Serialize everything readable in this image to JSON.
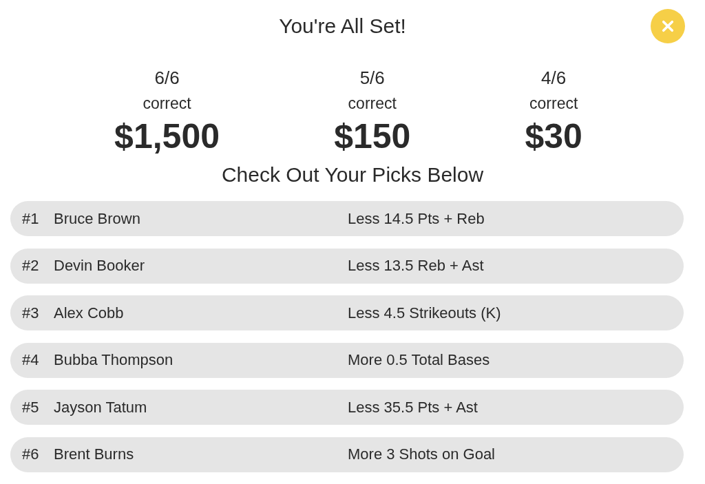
{
  "dialog": {
    "title": "You're All Set!"
  },
  "prizes": [
    {
      "score": "6/6",
      "label": "correct",
      "amount": "$1,500"
    },
    {
      "score": "5/6",
      "label": "correct",
      "amount": "$150"
    },
    {
      "score": "4/6",
      "label": "correct",
      "amount": "$30"
    }
  ],
  "picks_heading": "Check Out Your Picks Below",
  "picks": [
    {
      "number": "#1",
      "player": "Bruce Brown",
      "pick": "Less 14.5 Pts + Reb"
    },
    {
      "number": "#2",
      "player": "Devin Booker",
      "pick": "Less 13.5 Reb + Ast"
    },
    {
      "number": "#3",
      "player": "Alex Cobb",
      "pick": "Less 4.5 Strikeouts (K)"
    },
    {
      "number": "#4",
      "player": "Bubba Thompson",
      "pick": "More 0.5 Total Bases"
    },
    {
      "number": "#5",
      "player": "Jayson Tatum",
      "pick": "Less 35.5 Pts + Ast"
    },
    {
      "number": "#6",
      "player": "Brent Burns",
      "pick": "More 3 Shots on Goal"
    }
  ]
}
